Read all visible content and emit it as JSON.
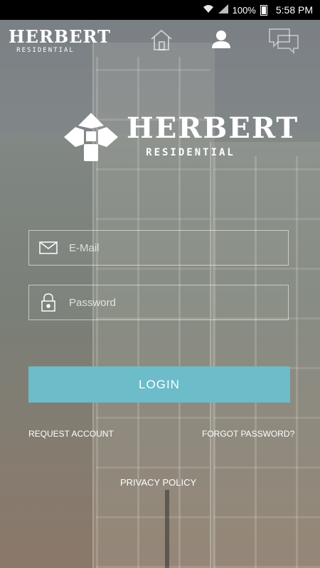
{
  "status_bar": {
    "battery": "100%",
    "time": "5:58 PM"
  },
  "brand": {
    "name": "HERBERT",
    "sub": "RESIDENTIAL"
  },
  "nav": {
    "icons": [
      "home-icon",
      "profile-icon",
      "chat-icon"
    ]
  },
  "login_form": {
    "email_placeholder": "E-Mail",
    "password_placeholder": "Password",
    "login_label": "LOGIN"
  },
  "links": {
    "request_account": "REQUEST ACCOUNT",
    "forgot_password": "FORGOT PASSWORD?",
    "privacy_policy": "PRIVACY POLICY"
  },
  "colors": {
    "accent": "#6cbcc9",
    "status_bar": "#000000"
  }
}
